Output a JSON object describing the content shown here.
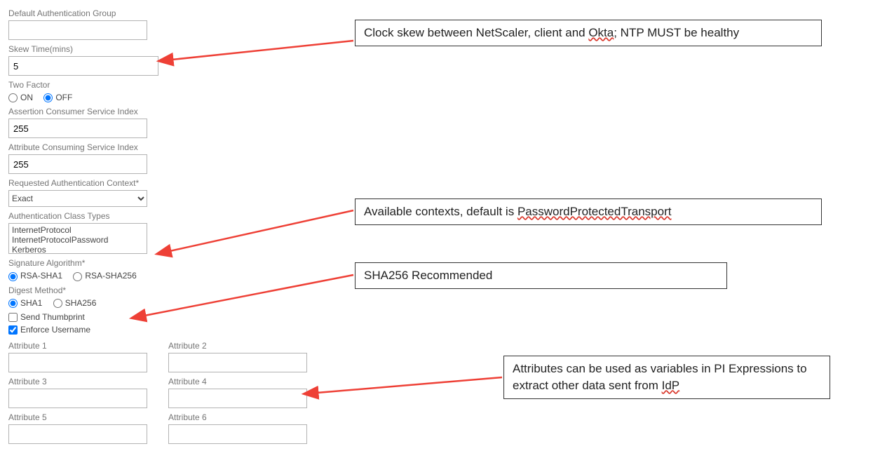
{
  "labels": {
    "default_auth_group": "Default Authentication Group",
    "skew_time": "Skew Time(mins)",
    "two_factor": "Two Factor",
    "on": "ON",
    "off": "OFF",
    "acs_index": "Assertion Consumer Service Index",
    "attr_consume_index": "Attribute Consuming Service Index",
    "req_authn_ctx": "Requested Authentication Context*",
    "authn_class_types": "Authentication Class Types",
    "sig_algo": "Signature Algorithm*",
    "rsa_sha1": "RSA-SHA1",
    "rsa_sha256": "RSA-SHA256",
    "digest_method": "Digest Method*",
    "sha1": "SHA1",
    "sha256": "SHA256",
    "send_thumbprint": "Send Thumbprint",
    "enforce_username": "Enforce Username",
    "attr1": "Attribute 1",
    "attr2": "Attribute 2",
    "attr3": "Attribute 3",
    "attr4": "Attribute 4",
    "attr5": "Attribute 5",
    "attr6": "Attribute 6"
  },
  "values": {
    "default_auth_group": "",
    "skew_time": "5",
    "two_factor": "OFF",
    "acs_index": "255",
    "attr_consume_index": "255",
    "req_authn_ctx_selected": "Exact",
    "class_types": [
      "InternetProtocol",
      "InternetProtocolPassword",
      "Kerberos"
    ],
    "sig_algo": "RSA-SHA1",
    "digest_method": "SHA1",
    "send_thumbprint": false,
    "enforce_username": true,
    "attr1": "",
    "attr2": "",
    "attr3": "",
    "attr4": "",
    "attr5": "",
    "attr6": ""
  },
  "callouts": {
    "skew": {
      "pre": "Clock skew between NetScaler, client and ",
      "u": "Okta",
      "post": "; NTP MUST be healthy"
    },
    "ctx": {
      "pre": "Available contexts, default is ",
      "u": "PasswordProtectedTransport",
      "post": ""
    },
    "sha": "SHA256 Recommended",
    "attr": {
      "pre": "Attributes can be used as variables in PI Expressions to extract other data sent from ",
      "u": "IdP",
      "post": ""
    }
  }
}
